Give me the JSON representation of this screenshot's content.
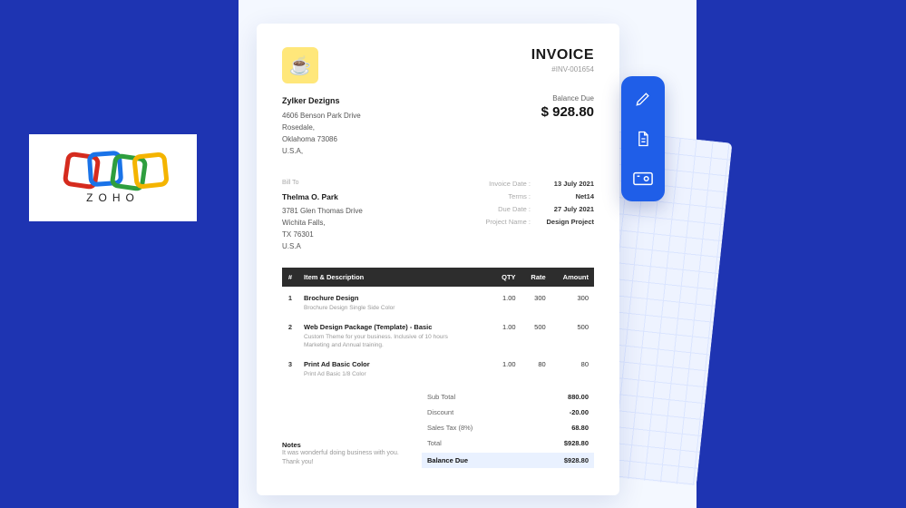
{
  "logo": {
    "brand": "ZOHO"
  },
  "invoice": {
    "title": "INVOICE",
    "number": "#INV-001654",
    "from": {
      "company": "Zylker Dezigns",
      "line1": "4606 Benson Park Drive",
      "line2": "Rosedale,",
      "line3": "Oklahoma 73086",
      "line4": "U.S.A,"
    },
    "balance_label": "Balance Due",
    "balance_amount": "$ 928.80",
    "billto_heading": "Bill To",
    "billto": {
      "name": "Thelma O. Park",
      "line1": "3781 Glen Thomas Drive",
      "line2": "Wichita Falls,",
      "line3": "TX 76301",
      "line4": "U.S.A"
    },
    "meta": [
      {
        "k": "Invoice Date :",
        "v": "13 July 2021"
      },
      {
        "k": "Terms :",
        "v": "Net14"
      },
      {
        "k": "Due Date :",
        "v": "27 July 2021"
      },
      {
        "k": "Project Name :",
        "v": "Design Project"
      }
    ],
    "cols": {
      "idx": "#",
      "desc": "Item & Description",
      "qty": "QTY",
      "rate": "Rate",
      "amount": "Amount"
    },
    "items": [
      {
        "idx": "1",
        "name": "Brochure Design",
        "desc": "Brochure Design Single Side Color",
        "qty": "1.00",
        "rate": "300",
        "amount": "300"
      },
      {
        "idx": "2",
        "name": "Web Design Package (Template) - Basic",
        "desc": "Custom Theme for your business. Inclusive of 10 hours Marketing and Annual training.",
        "qty": "1.00",
        "rate": "500",
        "amount": "500"
      },
      {
        "idx": "3",
        "name": "Print Ad Basic Color",
        "desc": "Print Ad Basic 1/8 Color",
        "qty": "1.00",
        "rate": "80",
        "amount": "80"
      }
    ],
    "totals": [
      {
        "k": "Sub Total",
        "v": "880.00"
      },
      {
        "k": "Discount",
        "v": "-20.00"
      },
      {
        "k": "Sales Tax (8%)",
        "v": "68.80"
      },
      {
        "k": "Total",
        "v": "$928.80"
      }
    ],
    "due_row": {
      "k": "Balance Due",
      "v": "$928.80"
    },
    "notes": {
      "heading": "Notes",
      "text": "It was wonderful doing business with you. Thank you!"
    }
  },
  "toolbar": {
    "edit": "edit-icon",
    "document": "document-icon",
    "payment": "payment-icon"
  }
}
